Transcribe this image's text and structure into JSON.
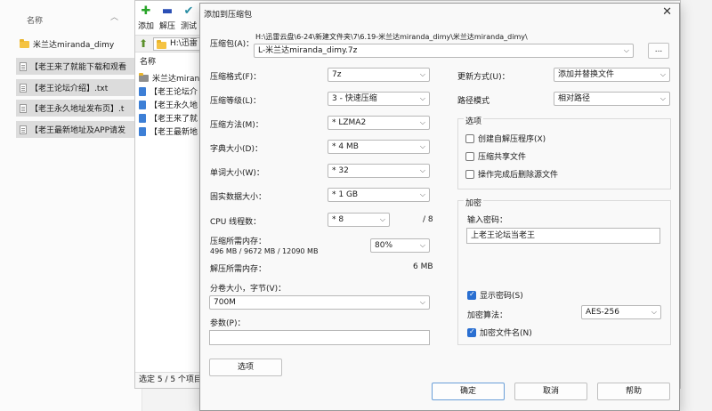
{
  "explorer": {
    "column_header": "名称",
    "items": [
      {
        "name": "米兰达miranda_dimy",
        "kind": "folder",
        "selected": false
      },
      {
        "name": "【老王来了就能下载和观看",
        "kind": "txt",
        "selected": true
      },
      {
        "name": "【老王论坛介绍】.txt",
        "kind": "txt",
        "selected": true
      },
      {
        "name": "【老王永久地址发布页】.t",
        "kind": "txt",
        "selected": true
      },
      {
        "name": "【老王最新地址及APP请发",
        "kind": "txt",
        "selected": true
      }
    ]
  },
  "zip_manager": {
    "toolbar": {
      "add": "添加",
      "extract": "解压",
      "test": "测试"
    },
    "address": "H:\\迅雷",
    "list_header": "名称",
    "rows": [
      "米兰达miran",
      "【老王论坛介",
      "【老王永久地",
      "【老王来了就",
      "【老王最新地"
    ],
    "status": "选定 5 / 5 个项目"
  },
  "dialog": {
    "title": "添加到压缩包",
    "archive_label": "压缩包(A)：",
    "archive_dir": "H:\\迅雷云盘\\6-24\\新建文件夹\\7\\6.19-米兰达miranda_dimy\\米兰达miranda_dimy\\",
    "archive_name": "L-米兰达miranda_dimy.7z",
    "browse_label": "...",
    "format_label": "压缩格式(F)：",
    "format_value": "7z",
    "level_label": "压缩等级(L)：",
    "level_value": "3 - 快速压缩",
    "method_label": "压缩方法(M)：",
    "method_value": "* LZMA2",
    "dict_label": "字典大小(D)：",
    "dict_value": "* 4 MB",
    "word_label": "单词大小(W)：",
    "word_value": "* 32",
    "solid_label": "固实数据大小：",
    "solid_value": "* 1 GB",
    "cpu_label": "CPU 线程数：",
    "cpu_value": "* 8",
    "cpu_total": "/ 8",
    "mem_comp_label": "压缩所需内存：",
    "mem_comp_value": "496 MB / 9672 MB / 12090 MB",
    "mem_percent": "80%",
    "mem_decomp_label": "解压所需内存：",
    "mem_decomp_value": "6 MB",
    "volume_label": "分卷大小，字节(V)：",
    "volume_value": "700M",
    "params_label": "参数(P)：",
    "params_value": "",
    "options_button": "选项",
    "update_label": "更新方式(U)：",
    "update_value": "添加并替换文件",
    "path_label": "路径模式",
    "path_value": "相对路径",
    "options_group": "选项",
    "opt_sfx": "创建自解压程序(X)",
    "opt_shared": "压缩共享文件",
    "opt_delete": "操作完成后删除源文件",
    "enc_group": "加密",
    "pwd_label": "输入密码：",
    "pwd_value": "上老王论坛当老王",
    "show_pwd": "显示密码(S)",
    "enc_method_label": "加密算法：",
    "enc_method_value": "AES-256",
    "enc_names": "加密文件名(N)",
    "ok": "确定",
    "cancel": "取消",
    "help": "帮助"
  }
}
